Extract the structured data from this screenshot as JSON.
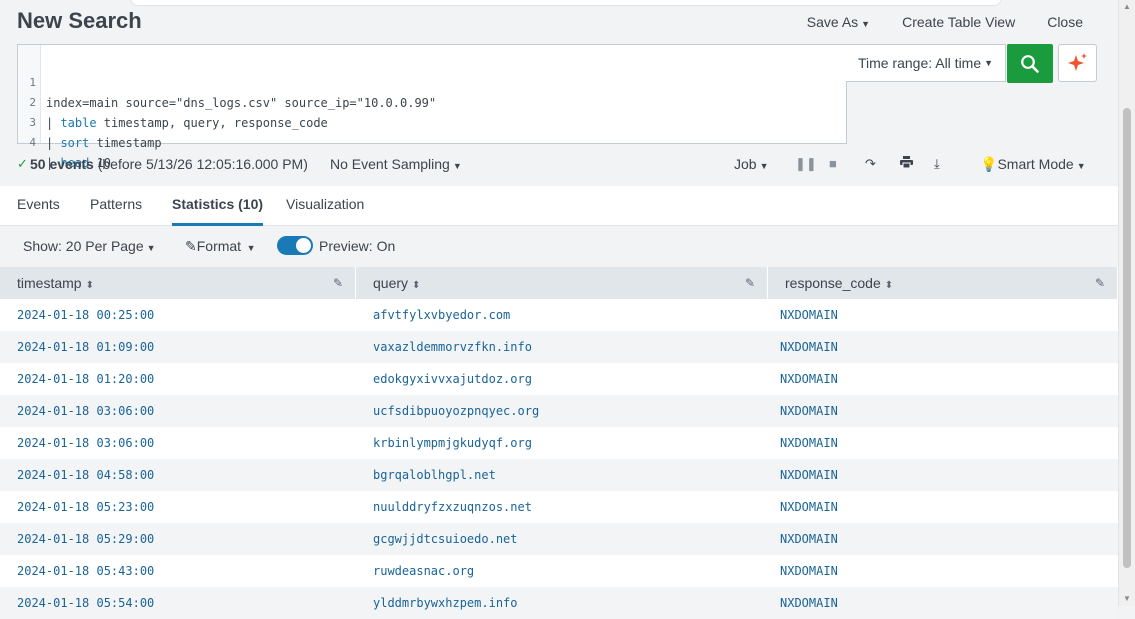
{
  "header": {
    "title": "New Search",
    "save_as": "Save As",
    "create_table_view": "Create Table View",
    "close": "Close"
  },
  "query": {
    "lines": [
      {
        "num": "1",
        "pipe": "",
        "kw": "",
        "rest": "index=main source=\"dns_logs.csv\" source_ip=\"10.0.0.99\""
      },
      {
        "num": "2",
        "pipe": "| ",
        "kw": "table",
        "rest": " timestamp, query, response_code"
      },
      {
        "num": "3",
        "pipe": "| ",
        "kw": "sort",
        "rest": " timestamp"
      },
      {
        "num": "4",
        "pipe": "| ",
        "kw": "head",
        "rest": " 10"
      }
    ],
    "time_range": "Time range: All time"
  },
  "status": {
    "event_count": "50 events",
    "event_detail": "(before 5/13/26 12:05:16.000 PM)",
    "sampling": "No Event Sampling",
    "job": "Job",
    "smart_mode": "Smart Mode"
  },
  "tabs": [
    {
      "label": "Events"
    },
    {
      "label": "Patterns"
    },
    {
      "label": "Statistics (10)"
    },
    {
      "label": "Visualization"
    }
  ],
  "options": {
    "show": "Show: 20 Per Page",
    "format": "Format",
    "preview": "Preview: On"
  },
  "table": {
    "columns": [
      "timestamp",
      "query",
      "response_code"
    ],
    "rows": [
      [
        "2024-01-18 00:25:00",
        "afvtfylxvbyedor.com",
        "NXDOMAIN"
      ],
      [
        "2024-01-18 01:09:00",
        "vaxazldemmorvzfkn.info",
        "NXDOMAIN"
      ],
      [
        "2024-01-18 01:20:00",
        "edokgyxivvxajutdoz.org",
        "NXDOMAIN"
      ],
      [
        "2024-01-18 03:06:00",
        "ucfsdibpuoyozpnqyec.org",
        "NXDOMAIN"
      ],
      [
        "2024-01-18 03:06:00",
        "krbinlympmjgkudyqf.org",
        "NXDOMAIN"
      ],
      [
        "2024-01-18 04:58:00",
        "bgrqaloblhgpl.net",
        "NXDOMAIN"
      ],
      [
        "2024-01-18 05:23:00",
        "nuulddryfzxzuqnzos.net",
        "NXDOMAIN"
      ],
      [
        "2024-01-18 05:29:00",
        "gcgwjjdtcsuioedo.net",
        "NXDOMAIN"
      ],
      [
        "2024-01-18 05:43:00",
        "ruwdeasnac.org",
        "NXDOMAIN"
      ],
      [
        "2024-01-18 05:54:00",
        "ylddmrbywxhzpem.info",
        "NXDOMAIN"
      ]
    ]
  },
  "colors": {
    "accent": "#1a7ab6",
    "search_button": "#1a9c3e",
    "ai_icon": "#f0532e"
  }
}
